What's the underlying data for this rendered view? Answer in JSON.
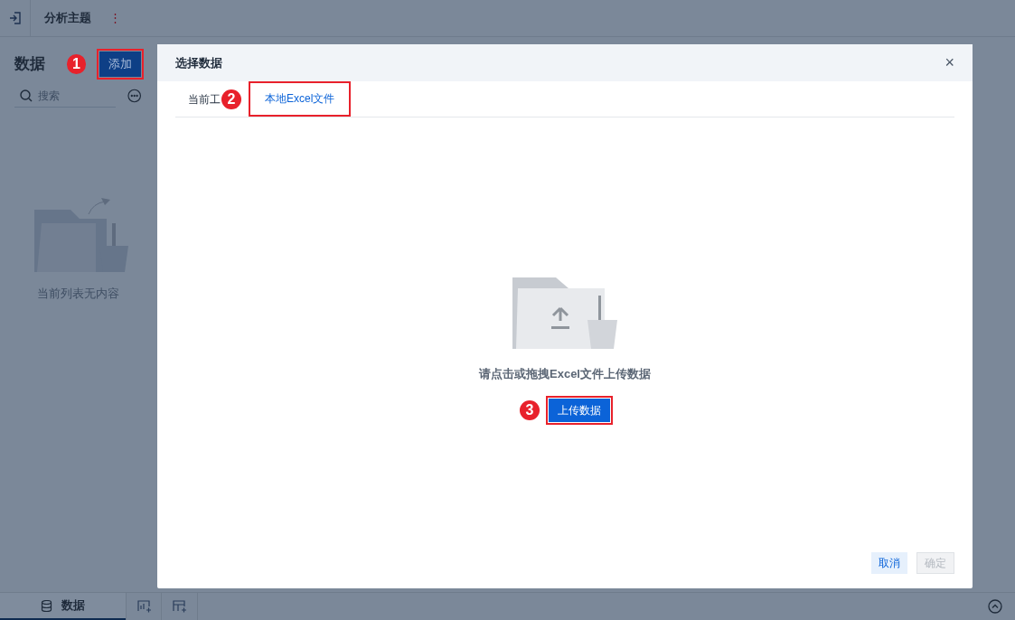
{
  "top_bar": {
    "title": "分析主题",
    "more": "⋮"
  },
  "sidebar": {
    "title": "数据",
    "add_button": {
      "label": "添加",
      "marker": "1"
    },
    "search": {
      "placeholder": "搜索"
    },
    "empty_text": "当前列表无内容"
  },
  "dialog": {
    "title": "选择数据",
    "close": "×",
    "tabs": [
      {
        "label": "当前工",
        "selected": false
      },
      {
        "label": "本地Excel文件",
        "selected": true,
        "marker": "2"
      }
    ],
    "hint": "请点击或拖拽Excel文件上传数据",
    "upload_button": {
      "label": "上传数据",
      "marker": "3"
    },
    "buttons": [
      {
        "label": "取消",
        "disabled": false
      },
      {
        "label": "确定",
        "disabled": true
      }
    ]
  },
  "bottom_bar": {
    "tabs": [
      {
        "label": "数据",
        "selected": true
      }
    ]
  }
}
